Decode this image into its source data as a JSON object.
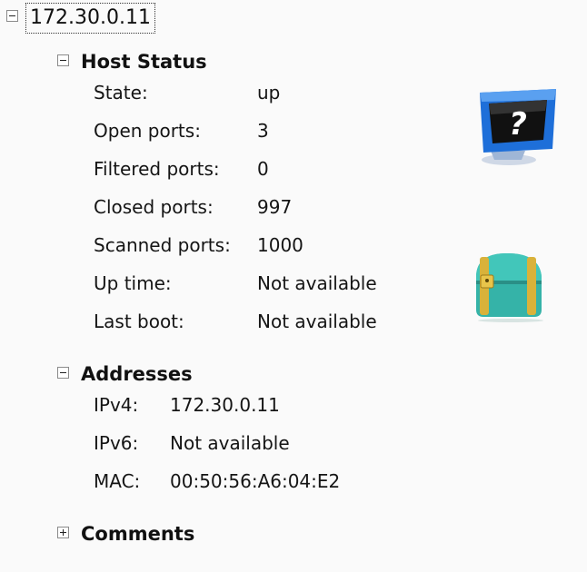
{
  "host": {
    "address": "172.30.0.11"
  },
  "host_status": {
    "title": "Host Status",
    "rows": [
      {
        "label": "State:",
        "value": "up"
      },
      {
        "label": "Open ports:",
        "value": "3"
      },
      {
        "label": "Filtered ports:",
        "value": "0"
      },
      {
        "label": "Closed ports:",
        "value": "997"
      },
      {
        "label": "Scanned ports:",
        "value": "1000"
      },
      {
        "label": "Up time:",
        "value": "Not available"
      },
      {
        "label": "Last boot:",
        "value": "Not available"
      }
    ]
  },
  "addresses": {
    "title": "Addresses",
    "rows": [
      {
        "label": "IPv4:",
        "value": "172.30.0.11"
      },
      {
        "label": "IPv6:",
        "value": "Not available"
      },
      {
        "label": "MAC:",
        "value": "00:50:56:A6:04:E2"
      }
    ]
  },
  "comments": {
    "title": "Comments"
  },
  "icons": {
    "os_icon": "unknown-os-monitor-icon",
    "chest_icon": "treasure-chest-icon"
  },
  "colors": {
    "background": "#fafafa",
    "monitor_blue": "#1e6fd9",
    "chest_teal": "#35b3a8",
    "chest_gold": "#d9b23a"
  }
}
